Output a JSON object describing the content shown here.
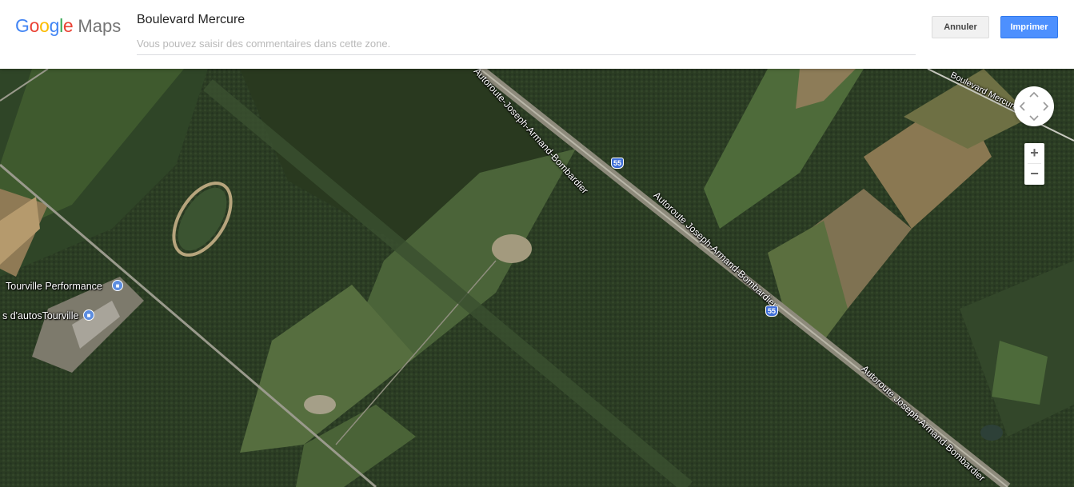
{
  "app": {
    "logo_word": "Google",
    "logo_product": "Maps"
  },
  "header": {
    "title": "Boulevard Mercure",
    "comment_placeholder": "Vous pouvez saisir des commentaires dans cette zone.",
    "comment_value": "",
    "cancel_label": "Annuler",
    "print_label": "Imprimer"
  },
  "map": {
    "view": "satellite",
    "colors": {
      "forest": "#2c3d24",
      "field": "#4a6138",
      "plowed": "#8a7a5c",
      "highway_shield": "#3f6fd8",
      "poi_pin": "#5c8de0"
    },
    "labels": {
      "boulevard": "Boulevard Mercure",
      "highway_1": "Autoroute-Joseph-Armand-Bombardier",
      "highway_2": "Autoroute Joseph-Armand-Bombardier",
      "highway_3": "Autoroute Joseph-Armand-Bombardier",
      "highway_number_1": "55",
      "highway_number_2": "55",
      "poi_1": "Tourville Performance",
      "poi_2": "s d'autosTourville"
    },
    "controls": {
      "zoom_in": "+",
      "zoom_out": "−"
    }
  }
}
